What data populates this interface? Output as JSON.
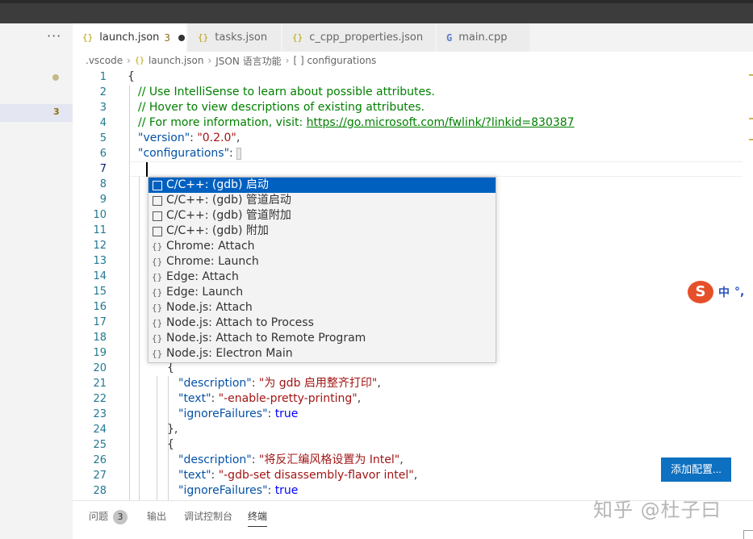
{
  "tabs": [
    {
      "label": "launch.json",
      "icon": "{}",
      "badge": "3",
      "dirty": true,
      "active": true
    },
    {
      "label": "tasks.json",
      "icon": "{}"
    },
    {
      "label": "c_cpp_properties.json",
      "icon": "{}"
    },
    {
      "label": "main.cpp",
      "icon": "G"
    }
  ],
  "sidebar": {
    "more": "···",
    "problem_count": "3"
  },
  "breadcrumb": [
    ".vscode",
    "launch.json",
    "JSON 语言功能",
    "[ ] configurations"
  ],
  "breadcrumb_icon": "{}",
  "lines": {
    "n": [
      "1",
      "2",
      "3",
      "4",
      "5",
      "6",
      "7",
      "8",
      "9",
      "10",
      "11",
      "12",
      "13",
      "14",
      "15",
      "16",
      "17",
      "18",
      "19",
      "20",
      "21",
      "22",
      "23",
      "24",
      "25",
      "26",
      "27",
      "28"
    ],
    "l1": "{",
    "l2": "// Use IntelliSense to learn about possible attributes.",
    "l3": "// Hover to view descriptions of existing attributes.",
    "l4_prefix": "// For more information, visit: ",
    "l4_link": "https://go.microsoft.com/fwlink/?linkid=830387",
    "l5_key": "\"version\"",
    "l5_val": "\"0.2.0\"",
    "l6_key": "\"configurations\"",
    "l20": "{",
    "l21_key": "\"description\"",
    "l21_val": "\"为 gdb 启用整齐打印\"",
    "l22_key": "\"text\"",
    "l22_val": "\"-enable-pretty-printing\"",
    "l23_key": "\"ignoreFailures\"",
    "l23_val": "true",
    "l24": "},",
    "l25": "{",
    "l26_key": "\"description\"",
    "l26_val": "\"将反汇编风格设置为 Intel\"",
    "l27_key": "\"text\"",
    "l27_val": "\"-gdb-set disassembly-flavor intel\"",
    "l28_key": "\"ignoreFailures\"",
    "l28_val": "true"
  },
  "punct": {
    "colon": ": ",
    "comma": ","
  },
  "suggestions": [
    {
      "label": "C/C++: (gdb) 启动",
      "icon": "box"
    },
    {
      "label": "C/C++: (gdb) 管道启动",
      "icon": "box"
    },
    {
      "label": "C/C++: (gdb) 管道附加",
      "icon": "box"
    },
    {
      "label": "C/C++: (gdb) 附加",
      "icon": "box"
    },
    {
      "label": "Chrome: Attach",
      "icon": "{}"
    },
    {
      "label": "Chrome: Launch",
      "icon": "{}"
    },
    {
      "label": "Edge: Attach",
      "icon": "{}"
    },
    {
      "label": "Edge: Launch",
      "icon": "{}"
    },
    {
      "label": "Node.js: Attach",
      "icon": "{}"
    },
    {
      "label": "Node.js: Attach to Process",
      "icon": "{}"
    },
    {
      "label": "Node.js: Attach to Remote Program",
      "icon": "{}"
    },
    {
      "label": "Node.js: Electron Main",
      "icon": "{}"
    }
  ],
  "ime": {
    "logo": "S",
    "lang": "中",
    "punct": "°,"
  },
  "add_config_label": "添加配置...",
  "panel": {
    "problems": "问题",
    "problems_count": "3",
    "output": "输出",
    "debug_console": "调试控制台",
    "terminal": "终端"
  },
  "watermark": "知乎 @杜子曰",
  "colors": {
    "accent": "#0e70c0",
    "selection": "#0060c0",
    "string": "#a31515",
    "key": "#0451a5",
    "comment": "#008000",
    "keyword": "#0000ff"
  }
}
